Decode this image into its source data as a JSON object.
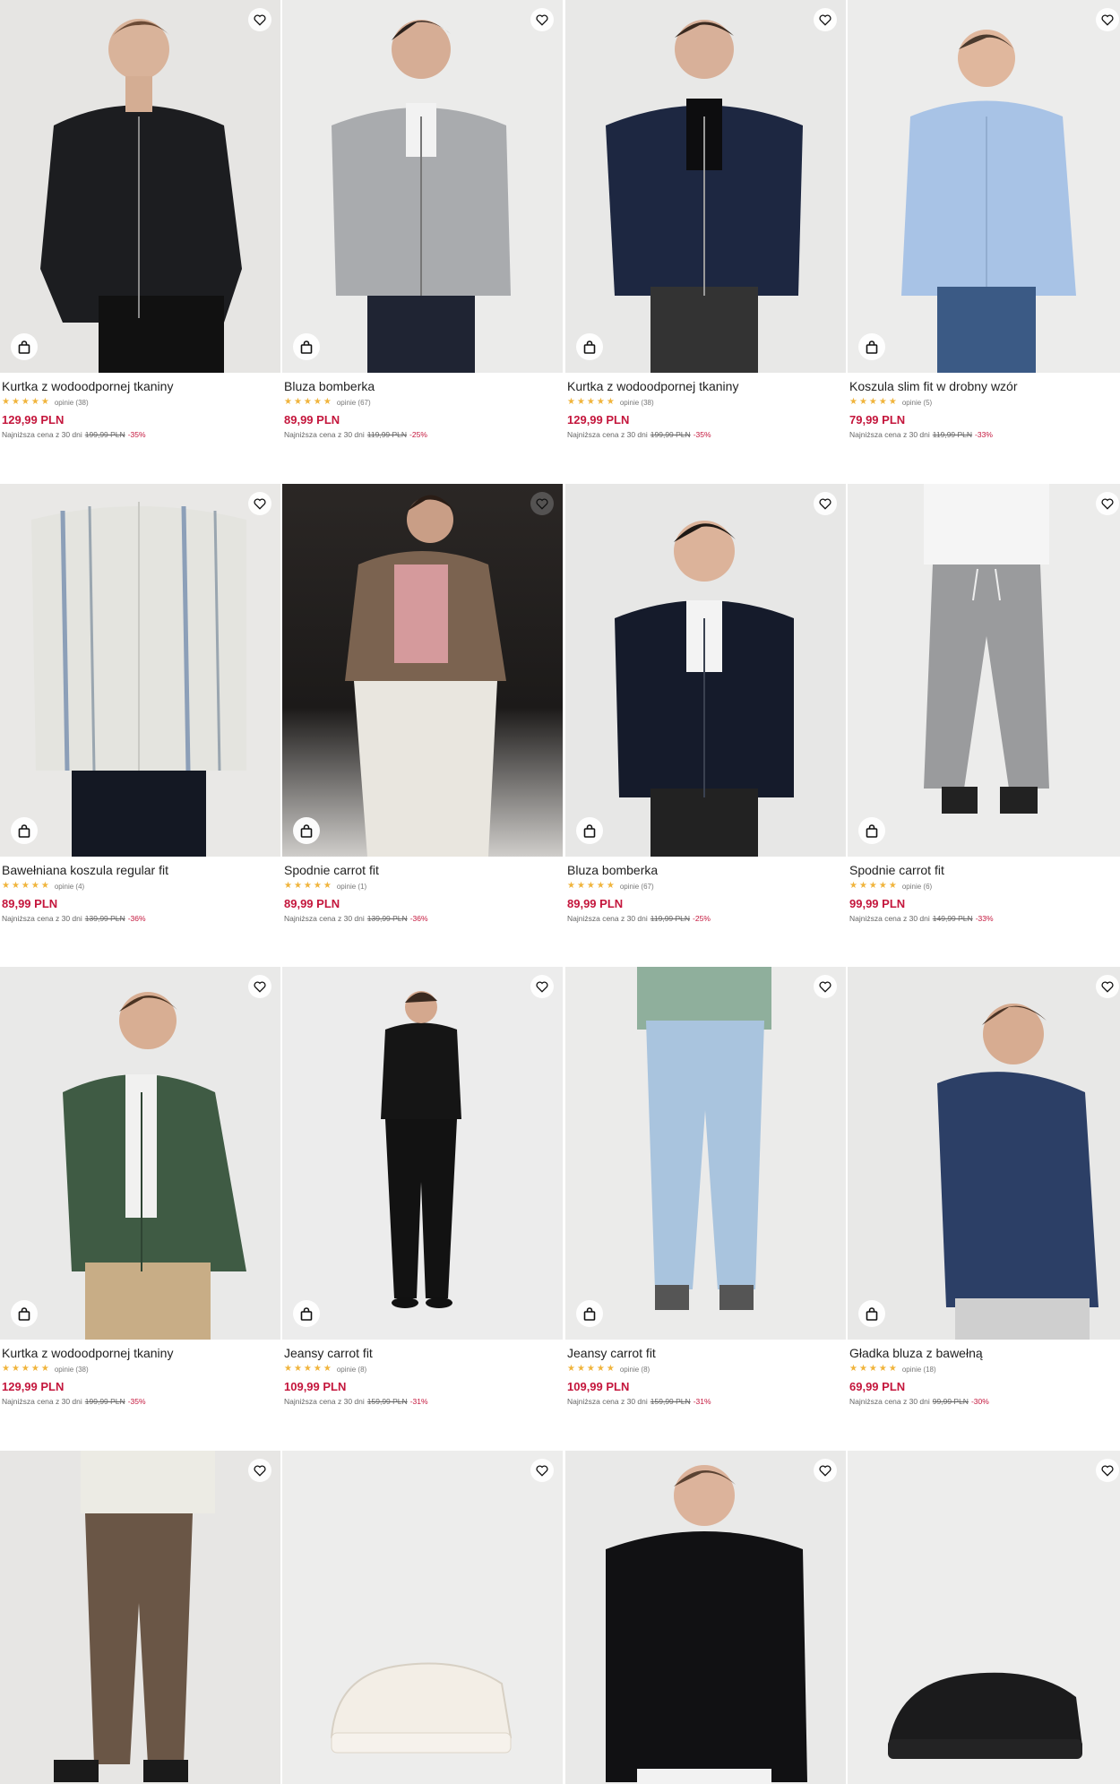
{
  "icons": {
    "favorite": "heart-outline-icon",
    "cart": "shopping-bag-icon",
    "star": "star-icon"
  },
  "colors": {
    "price": "#c4163c",
    "star": "#f0b43c",
    "text": "#222222"
  },
  "products": [
    {
      "name": "Kurtka z wodoodpornej tkaniny",
      "rating": 5,
      "reviews": "opinie (38)",
      "price": "129,99 PLN",
      "lowest_label": "Najniższa cena z 30 dni",
      "old_price": "199,99 PLN",
      "discount": "-35%"
    },
    {
      "name": "Bluza bomberka",
      "rating": 5,
      "reviews": "opinie (67)",
      "price": "89,99 PLN",
      "lowest_label": "Najniższa cena z 30 dni",
      "old_price": "119,99 PLN",
      "discount": "-25%"
    },
    {
      "name": "Kurtka z wodoodpornej tkaniny",
      "rating": 5,
      "reviews": "opinie (38)",
      "price": "129,99 PLN",
      "lowest_label": "Najniższa cena z 30 dni",
      "old_price": "199,99 PLN",
      "discount": "-35%"
    },
    {
      "name": "Koszula slim fit w drobny wzór",
      "rating": 5,
      "reviews": "opinie (5)",
      "price": "79,99 PLN",
      "lowest_label": "Najniższa cena z 30 dni",
      "old_price": "119,99 PLN",
      "discount": "-33%"
    },
    {
      "name": "Bawełniana koszula regular fit",
      "rating": 5,
      "reviews": "opinie (4)",
      "price": "89,99 PLN",
      "lowest_label": "Najniższa cena z 30 dni",
      "old_price": "139,99 PLN",
      "discount": "-36%"
    },
    {
      "name": "Spodnie carrot fit",
      "rating": 5,
      "reviews": "opinie (1)",
      "price": "89,99 PLN",
      "lowest_label": "Najniższa cena z 30 dni",
      "old_price": "139,99 PLN",
      "discount": "-36%"
    },
    {
      "name": "Bluza bomberka",
      "rating": 5,
      "reviews": "opinie (67)",
      "price": "89,99 PLN",
      "lowest_label": "Najniższa cena z 30 dni",
      "old_price": "119,99 PLN",
      "discount": "-25%"
    },
    {
      "name": "Spodnie carrot fit",
      "rating": 5,
      "reviews": "opinie (6)",
      "price": "99,99 PLN",
      "lowest_label": "Najniższa cena z 30 dni",
      "old_price": "149,99 PLN",
      "discount": "-33%"
    },
    {
      "name": "Kurtka z wodoodpornej tkaniny",
      "rating": 5,
      "reviews": "opinie (38)",
      "price": "129,99 PLN",
      "lowest_label": "Najniższa cena z 30 dni",
      "old_price": "199,99 PLN",
      "discount": "-35%"
    },
    {
      "name": "Jeansy carrot fit",
      "rating": 5,
      "reviews": "opinie (8)",
      "price": "109,99 PLN",
      "lowest_label": "Najniższa cena z 30 dni",
      "old_price": "159,99 PLN",
      "discount": "-31%"
    },
    {
      "name": "Jeansy carrot fit",
      "rating": 5,
      "reviews": "opinie (8)",
      "price": "109,99 PLN",
      "lowest_label": "Najniższa cena z 30 dni",
      "old_price": "159,99 PLN",
      "discount": "-31%"
    },
    {
      "name": "Gładka bluza z bawełną",
      "rating": 5,
      "reviews": "opinie (18)",
      "price": "69,99 PLN",
      "lowest_label": "Najniższa cena z 30 dni",
      "old_price": "99,99 PLN",
      "discount": "-30%"
    },
    {
      "name": "",
      "rating": 0,
      "reviews": "",
      "price": "",
      "lowest_label": "",
      "old_price": "",
      "discount": ""
    },
    {
      "name": "",
      "rating": 0,
      "reviews": "",
      "price": "",
      "lowest_label": "",
      "old_price": "",
      "discount": ""
    },
    {
      "name": "",
      "rating": 0,
      "reviews": "",
      "price": "",
      "lowest_label": "",
      "old_price": "",
      "discount": ""
    },
    {
      "name": "",
      "rating": 0,
      "reviews": "",
      "price": "",
      "lowest_label": "",
      "old_price": "",
      "discount": ""
    }
  ]
}
